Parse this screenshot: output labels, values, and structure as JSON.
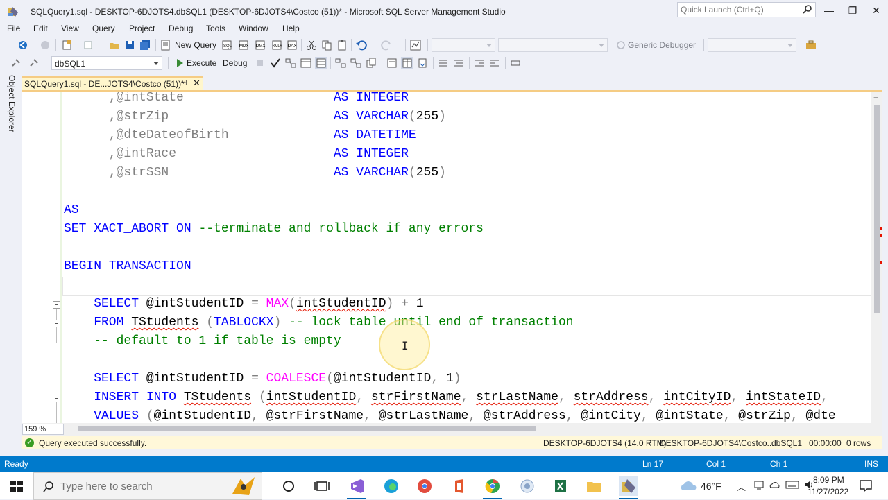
{
  "window": {
    "title": "SQLQuery1.sql - DESKTOP-6DJOTS4.dbSQL1 (DESKTOP-6DJOTS4\\Costco (51))* - Microsoft SQL Server Management Studio",
    "quick_launch_placeholder": "Quick Launch (Ctrl+Q)"
  },
  "menu": [
    "File",
    "Edit",
    "View",
    "Query",
    "Project",
    "Debug",
    "Tools",
    "Window",
    "Help"
  ],
  "toolbar": {
    "new_query_label": "New Query",
    "generic_debugger_label": "Generic Debugger",
    "database_selected": "dbSQL1",
    "execute_label": "Execute",
    "debug_label": "Debug"
  },
  "side": {
    "object_explorer_label": "Object Explorer"
  },
  "document_tab": {
    "label": "SQLQuery1.sql - DE...JOTS4\\Costco (51))*",
    "pin_glyph": "⊣",
    "close_glyph": "✕"
  },
  "code_lines": [
    {
      "segments": [
        {
          "text": "      ,@intState",
          "cls": "gr"
        },
        {
          "text": "                    ",
          "cls": ""
        },
        {
          "text": "AS INTEGER",
          "cls": "kw"
        }
      ]
    },
    {
      "segments": [
        {
          "text": "      ,@strZip",
          "cls": "gr"
        },
        {
          "text": "                      ",
          "cls": ""
        },
        {
          "text": "AS VARCHAR",
          "cls": "kw"
        },
        {
          "text": "(",
          "cls": "gr"
        },
        {
          "text": "255",
          "cls": ""
        },
        {
          "text": ")",
          "cls": "gr"
        }
      ]
    },
    {
      "segments": [
        {
          "text": "      ,@dteDateofBirth",
          "cls": "gr"
        },
        {
          "text": "              ",
          "cls": ""
        },
        {
          "text": "AS DATETIME",
          "cls": "kw"
        }
      ]
    },
    {
      "segments": [
        {
          "text": "      ,@intRace",
          "cls": "gr"
        },
        {
          "text": "                     ",
          "cls": ""
        },
        {
          "text": "AS INTEGER",
          "cls": "kw"
        }
      ]
    },
    {
      "segments": [
        {
          "text": "      ,@strSSN",
          "cls": "gr"
        },
        {
          "text": "                      ",
          "cls": ""
        },
        {
          "text": "AS VARCHAR",
          "cls": "kw"
        },
        {
          "text": "(",
          "cls": "gr"
        },
        {
          "text": "255",
          "cls": ""
        },
        {
          "text": ")",
          "cls": "gr"
        }
      ]
    },
    {
      "segments": []
    },
    {
      "segments": [
        {
          "text": "AS",
          "cls": "kw"
        }
      ]
    },
    {
      "segments": [
        {
          "text": "SET XACT_ABORT ON ",
          "cls": "kw"
        },
        {
          "text": "--terminate and rollback if any errors",
          "cls": "cm"
        }
      ]
    },
    {
      "segments": []
    },
    {
      "segments": [
        {
          "text": "BEGIN TRANSACTION",
          "cls": "kw"
        }
      ]
    },
    {
      "segments": []
    },
    {
      "segments": [
        {
          "text": "    SELECT ",
          "cls": "kw"
        },
        {
          "text": "@intStudentID ",
          "cls": ""
        },
        {
          "text": "= ",
          "cls": "gr"
        },
        {
          "text": "MAX",
          "cls": "fn"
        },
        {
          "text": "(",
          "cls": "gr"
        },
        {
          "text": "intStudentID",
          "cls": "sq"
        },
        {
          "text": ") + ",
          "cls": "gr"
        },
        {
          "text": "1",
          "cls": ""
        }
      ]
    },
    {
      "segments": [
        {
          "text": "    FROM ",
          "cls": "kw"
        },
        {
          "text": "TStudents",
          "cls": "sq"
        },
        {
          "text": " (",
          "cls": "gr"
        },
        {
          "text": "TABLOCKX",
          "cls": "kw"
        },
        {
          "text": ") ",
          "cls": "gr"
        },
        {
          "text": "-- lock table until end of transaction",
          "cls": "cm"
        }
      ]
    },
    {
      "segments": [
        {
          "text": "    -- default to 1 if table is empty",
          "cls": "cm"
        }
      ]
    },
    {
      "segments": []
    },
    {
      "segments": [
        {
          "text": "    SELECT ",
          "cls": "kw"
        },
        {
          "text": "@intStudentID ",
          "cls": ""
        },
        {
          "text": "= ",
          "cls": "gr"
        },
        {
          "text": "COALESCE",
          "cls": "fn"
        },
        {
          "text": "(",
          "cls": "gr"
        },
        {
          "text": "@intStudentID",
          "cls": ""
        },
        {
          "text": ", ",
          "cls": "gr"
        },
        {
          "text": "1",
          "cls": ""
        },
        {
          "text": ")",
          "cls": "gr"
        }
      ]
    },
    {
      "segments": [
        {
          "text": "    INSERT INTO ",
          "cls": "kw"
        },
        {
          "text": "TStudents",
          "cls": "sq"
        },
        {
          "text": " (",
          "cls": "gr"
        },
        {
          "text": "intStudentID",
          "cls": "sq"
        },
        {
          "text": ", ",
          "cls": "gr"
        },
        {
          "text": "strFirstName",
          "cls": "sq"
        },
        {
          "text": ", ",
          "cls": "gr"
        },
        {
          "text": "strLastName",
          "cls": "sq"
        },
        {
          "text": ", ",
          "cls": "gr"
        },
        {
          "text": "strAddress",
          "cls": "sq"
        },
        {
          "text": ", ",
          "cls": "gr"
        },
        {
          "text": "intCityID",
          "cls": "sq"
        },
        {
          "text": ", ",
          "cls": "gr"
        },
        {
          "text": "intStateID",
          "cls": "sq"
        },
        {
          "text": ",",
          "cls": "gr"
        }
      ]
    },
    {
      "segments": [
        {
          "text": "    VALUES ",
          "cls": "kw"
        },
        {
          "text": "(",
          "cls": "gr"
        },
        {
          "text": "@intStudentID",
          "cls": ""
        },
        {
          "text": ", ",
          "cls": "gr"
        },
        {
          "text": "@strFirstName",
          "cls": ""
        },
        {
          "text": ", ",
          "cls": "gr"
        },
        {
          "text": "@strLastName",
          "cls": ""
        },
        {
          "text": ", ",
          "cls": "gr"
        },
        {
          "text": "@strAddress",
          "cls": ""
        },
        {
          "text": ", ",
          "cls": "gr"
        },
        {
          "text": "@intCity",
          "cls": ""
        },
        {
          "text": ", ",
          "cls": "gr"
        },
        {
          "text": "@intState",
          "cls": ""
        },
        {
          "text": ", ",
          "cls": "gr"
        },
        {
          "text": "@strZip",
          "cls": ""
        },
        {
          "text": ", ",
          "cls": "gr"
        },
        {
          "text": "@dte",
          "cls": ""
        }
      ]
    }
  ],
  "editor": {
    "zoom": "159 %"
  },
  "query_status": {
    "message": "Query executed successfully.",
    "server": "DESKTOP-6DJOTS4 (14.0 RTM)",
    "login": "DESKTOP-6DJOTS4\\Costco...",
    "database": "dbSQL1",
    "elapsed": "00:00:00",
    "rows": "0 rows"
  },
  "status_bar": {
    "state": "Ready",
    "line": "Ln 17",
    "col": "Col 1",
    "ch": "Ch 1",
    "mode": "INS"
  },
  "taskbar": {
    "search_placeholder": "Type here to search",
    "temperature": "46°F",
    "time": "8:09 PM",
    "date": "11/27/2022"
  },
  "colors": {
    "accent": "#007acc",
    "keyword": "#0000ff",
    "comment": "#008000",
    "function": "#ff00ff",
    "tab_active": "#fff6cc"
  }
}
